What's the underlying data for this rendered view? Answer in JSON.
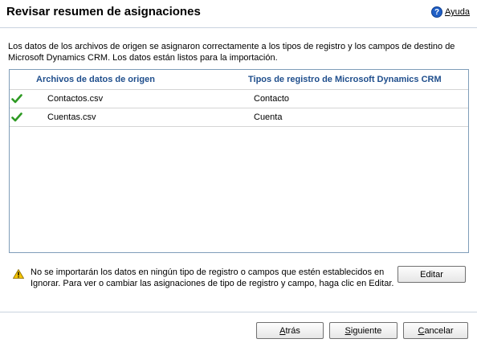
{
  "header": {
    "title": "Revisar resumen de asignaciones",
    "help_label": "Ayuda",
    "help_icon": "help-question-icon"
  },
  "intro_text": "Los datos de los archivos de origen se asignaron correctamente a los tipos de registro y los campos de destino de Microsoft Dynamics CRM. Los datos están listos para la importación.",
  "grid": {
    "columns": [
      "Archivos de datos de origen",
      "Tipos de registro de Microsoft Dynamics CRM"
    ],
    "rows": [
      {
        "status_icon": "green-check-icon",
        "source_file": "Contactos.csv",
        "record_type": "Contacto"
      },
      {
        "status_icon": "green-check-icon",
        "source_file": "Cuentas.csv",
        "record_type": "Cuenta"
      }
    ]
  },
  "warning": {
    "icon": "warning-triangle-icon",
    "text": "No se importarán los datos en ningún tipo de registro o campos que estén establecidos en Ignorar. Para ver o cambiar las asignaciones de tipo de registro y campo, haga clic en Editar."
  },
  "buttons": {
    "edit": "Editar",
    "back_accel": "A",
    "back_rest": "trás",
    "next_accel": "S",
    "next_rest": "iguiente",
    "cancel_accel": "C",
    "cancel_rest": "ancelar"
  },
  "colors": {
    "column_header": "#1f4e8c",
    "check": "#2e9a23",
    "warning": "#f5c400"
  }
}
